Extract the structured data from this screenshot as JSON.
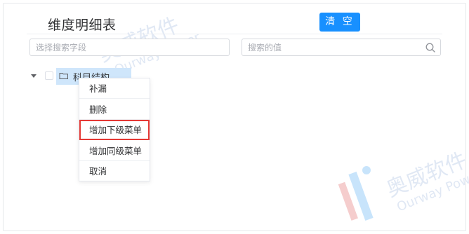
{
  "header": {
    "title": "维度明细表",
    "clear_label": "清 空"
  },
  "search": {
    "field_placeholder": "选择搜索字段",
    "value_placeholder": "搜索的值"
  },
  "tree": {
    "node_label": "科目结构"
  },
  "context_menu": {
    "items": [
      {
        "label": "补漏"
      },
      {
        "label": "删除"
      },
      {
        "label": "增加下级菜单",
        "selected": true
      },
      {
        "label": "增加同级菜单"
      },
      {
        "label": "取消"
      }
    ]
  },
  "watermark": {
    "brand": "奥威软件",
    "brand_en": "Ourway Power"
  },
  "colors": {
    "accent": "#1890ff",
    "highlight": "#e53935",
    "node_selected_bg": "#cfe6fb"
  }
}
